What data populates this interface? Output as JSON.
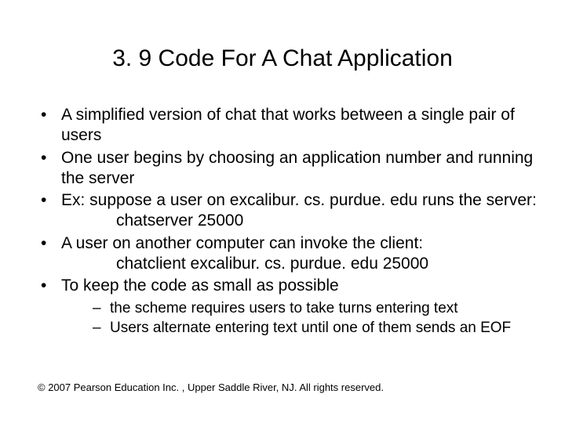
{
  "title": "3. 9 Code For A Chat Application",
  "bullets": [
    {
      "text": "A simplified version of chat that works between a single pair of users"
    },
    {
      "text": "One user begins by choosing an application number and running the server"
    },
    {
      "text": "Ex: suppose a user on  excalibur. cs. purdue. edu  runs the server:",
      "code": "chatserver  25000"
    },
    {
      "text": "A user on another computer can invoke the client:",
      "code": "chatclient  excalibur. cs. purdue. edu  25000"
    },
    {
      "text": "To keep the code as small as possible"
    }
  ],
  "subbullets": [
    "the scheme requires users to take turns entering text",
    "Users alternate entering text until one of them sends an EOF"
  ],
  "footer": "© 2007 Pearson Education Inc. , Upper Saddle River, NJ. All rights reserved."
}
